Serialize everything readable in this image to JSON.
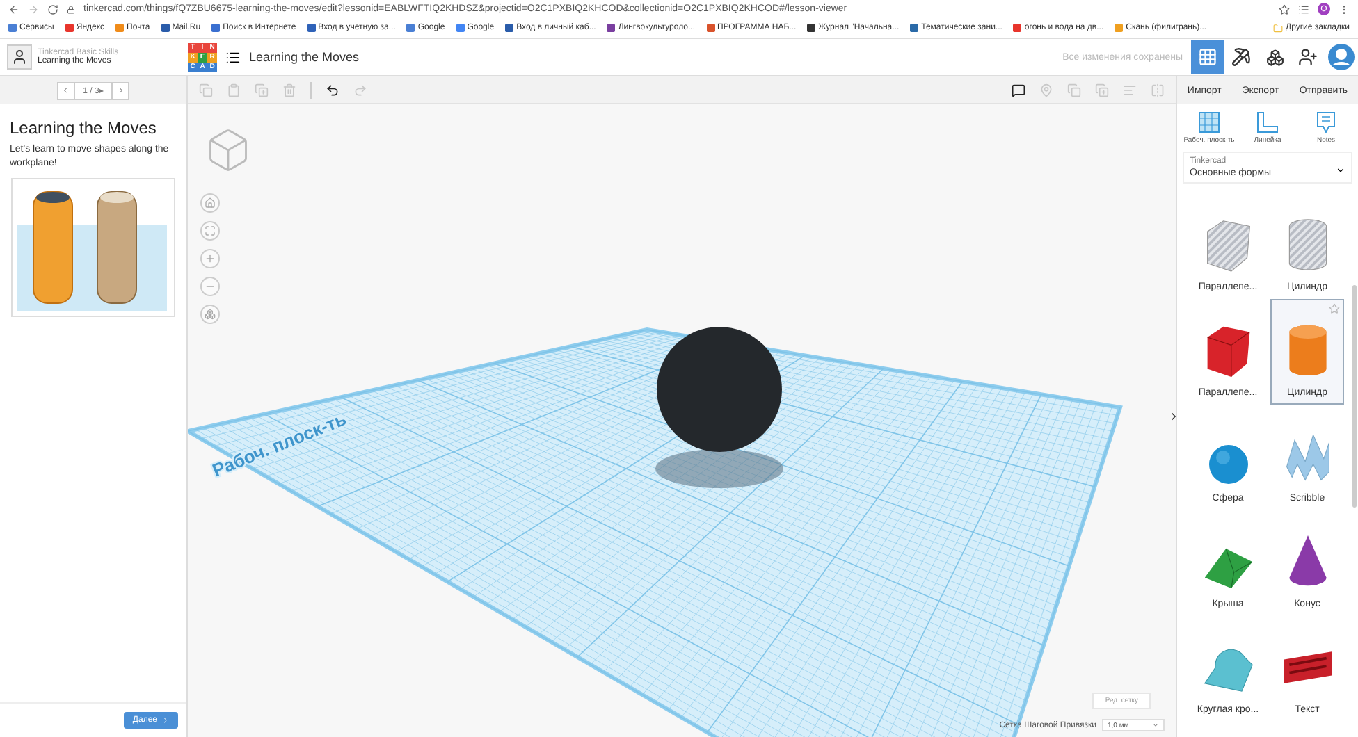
{
  "browser": {
    "url": "tinkercad.com/things/fQ7ZBU6675-learning-the-moves/edit?lessonid=EABLWFTIQ2KHDSZ&projectid=O2C1PXBIQ2KHCOD&collectionid=O2C1PXBIQ2KHCOD#/lesson-viewer",
    "profile_initial": "О",
    "bookmarks": [
      {
        "label": "Сервисы",
        "color": "#4a7fd4"
      },
      {
        "label": "Яндекс",
        "color": "#e8352c"
      },
      {
        "label": "Почта",
        "color": "#f08c1a"
      },
      {
        "label": "Mail.Ru",
        "color": "#2a5caa"
      },
      {
        "label": "Поиск в Интернете",
        "color": "#3a6fd0"
      },
      {
        "label": "Вход в учетную за...",
        "color": "#2f62b8"
      },
      {
        "label": "Google",
        "color": "#4a7fd4"
      },
      {
        "label": "Google",
        "color": "#4285f4"
      },
      {
        "label": "Вход в личный каб...",
        "color": "#2a5caa"
      },
      {
        "label": "Лингвокультуроло...",
        "color": "#7a3fa0"
      },
      {
        "label": "ПРОГРАММА НАБ...",
        "color": "#d9532c"
      },
      {
        "label": "Журнал \"Начальна...",
        "color": "#333333"
      },
      {
        "label": "Тематические зани...",
        "color": "#2a6aa8"
      },
      {
        "label": "огонь и вода на дв...",
        "color": "#e8352c"
      },
      {
        "label": "Скань (филигрань)...",
        "color": "#f0a020"
      }
    ],
    "other_bookmarks": "Другие закладки"
  },
  "header": {
    "course": "Tinkercad Basic Skills",
    "lesson": "Learning the Moves",
    "logo_letters": [
      "T",
      "I",
      "N",
      "K",
      "E",
      "R",
      "C",
      "A",
      "D"
    ],
    "design_title": "Learning the Moves",
    "save_status": "Все изменения сохранены"
  },
  "lesson": {
    "pager": "1 / 3▸",
    "title": "Learning the Moves",
    "description": "Let's learn to move shapes along the workplane!",
    "next_button": "Далее"
  },
  "workplane": {
    "label": "Рабоч. плоск-ть",
    "edit_grid": "Ред. сетку",
    "snap_label": "Сетка Шаговой Привязки",
    "snap_value": "1,0 мм"
  },
  "right_panel": {
    "actions": [
      "Импорт",
      "Экспорт",
      "Отправить"
    ],
    "tools": [
      {
        "kind": "workplane",
        "label": "Рабоч. плоск-ть"
      },
      {
        "kind": "ruler",
        "label": "Линейка"
      },
      {
        "kind": "notes",
        "label": "Notes"
      }
    ],
    "library": {
      "source": "Tinkercad",
      "category": "Основные формы"
    },
    "shapes": [
      {
        "kind": "box-hole",
        "label": "Параллепе...",
        "color": "#b8bcc4",
        "selected": false
      },
      {
        "kind": "cylinder-hole",
        "label": "Цилиндр",
        "color": "#b8bcc4",
        "selected": false
      },
      {
        "kind": "box",
        "label": "Параллепе...",
        "color": "#d8232a",
        "selected": false
      },
      {
        "kind": "cylinder",
        "label": "Цилиндр",
        "color": "#ec7d1c",
        "selected": true
      },
      {
        "kind": "sphere",
        "label": "Сфера",
        "color": "#1a8fd0",
        "selected": false
      },
      {
        "kind": "scribble",
        "label": "Scribble",
        "color": "#9cc8e8",
        "selected": false
      },
      {
        "kind": "roof",
        "label": "Крыша",
        "color": "#2ea043",
        "selected": false
      },
      {
        "kind": "cone",
        "label": "Конус",
        "color": "#8a3aa8",
        "selected": false
      },
      {
        "kind": "round-roof",
        "label": "Круглая кро...",
        "color": "#5bc0d0",
        "selected": false
      },
      {
        "kind": "text",
        "label": "Текст",
        "color": "#c8202a",
        "selected": false
      }
    ]
  }
}
